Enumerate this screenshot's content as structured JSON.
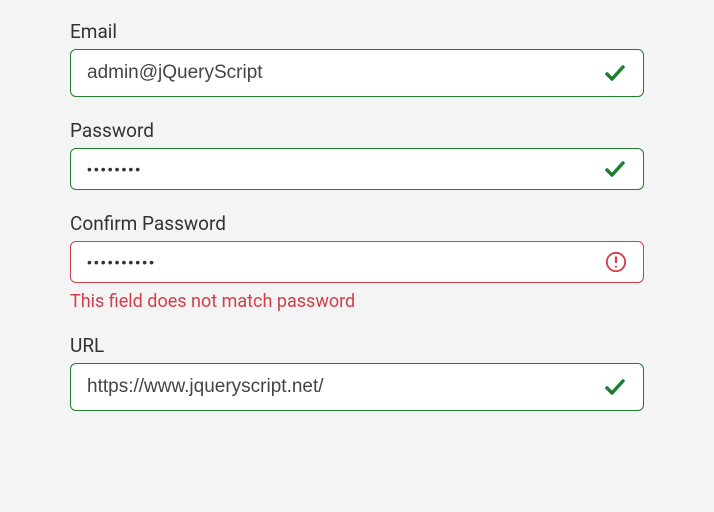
{
  "form": {
    "email": {
      "label": "Email",
      "value": "admin@jQueryScript",
      "status": "valid"
    },
    "password": {
      "label": "Password",
      "value": "••••••••",
      "status": "valid"
    },
    "confirm_password": {
      "label": "Confirm Password",
      "value": "••••••••••",
      "status": "invalid",
      "error": "This field does not match password"
    },
    "url": {
      "label": "URL",
      "value": "https://www.jqueryscript.net/",
      "status": "valid"
    }
  },
  "colors": {
    "valid_border": "#1e7e34",
    "invalid_border": "#d13e4a",
    "check": "#1e7e34",
    "alert": "#d13e4a"
  }
}
